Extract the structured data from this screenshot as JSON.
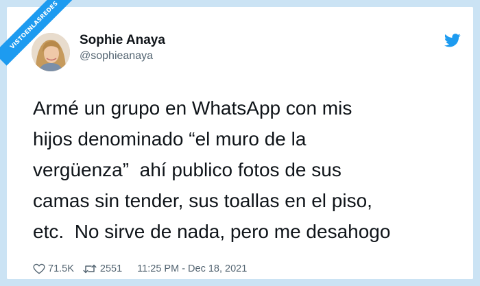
{
  "watermark": "VISTOENLASREDES",
  "author": {
    "name": "Sophie Anaya",
    "handle": "@sophieanaya"
  },
  "tweet": {
    "lines": [
      "Armé un grupo en WhatsApp con mis",
      "hijos denominado “el muro de la",
      "vergüenza”  ahí publico fotos de sus",
      "camas sin tender, sus toallas en el piso,",
      "etc.  No sirve de nada, pero me desahogo"
    ]
  },
  "footer": {
    "likes": "71.5K",
    "retweets": "2551",
    "timestamp": "11:25 PM - Dec 18, 2021"
  },
  "icons": {
    "like": "heart-icon",
    "retweet": "retweet-icon",
    "logo": "twitter-bird-icon"
  },
  "colors": {
    "accent": "#1d9bf0",
    "background": "#cbe3f4",
    "text": "#0f1419",
    "muted": "#536471"
  }
}
